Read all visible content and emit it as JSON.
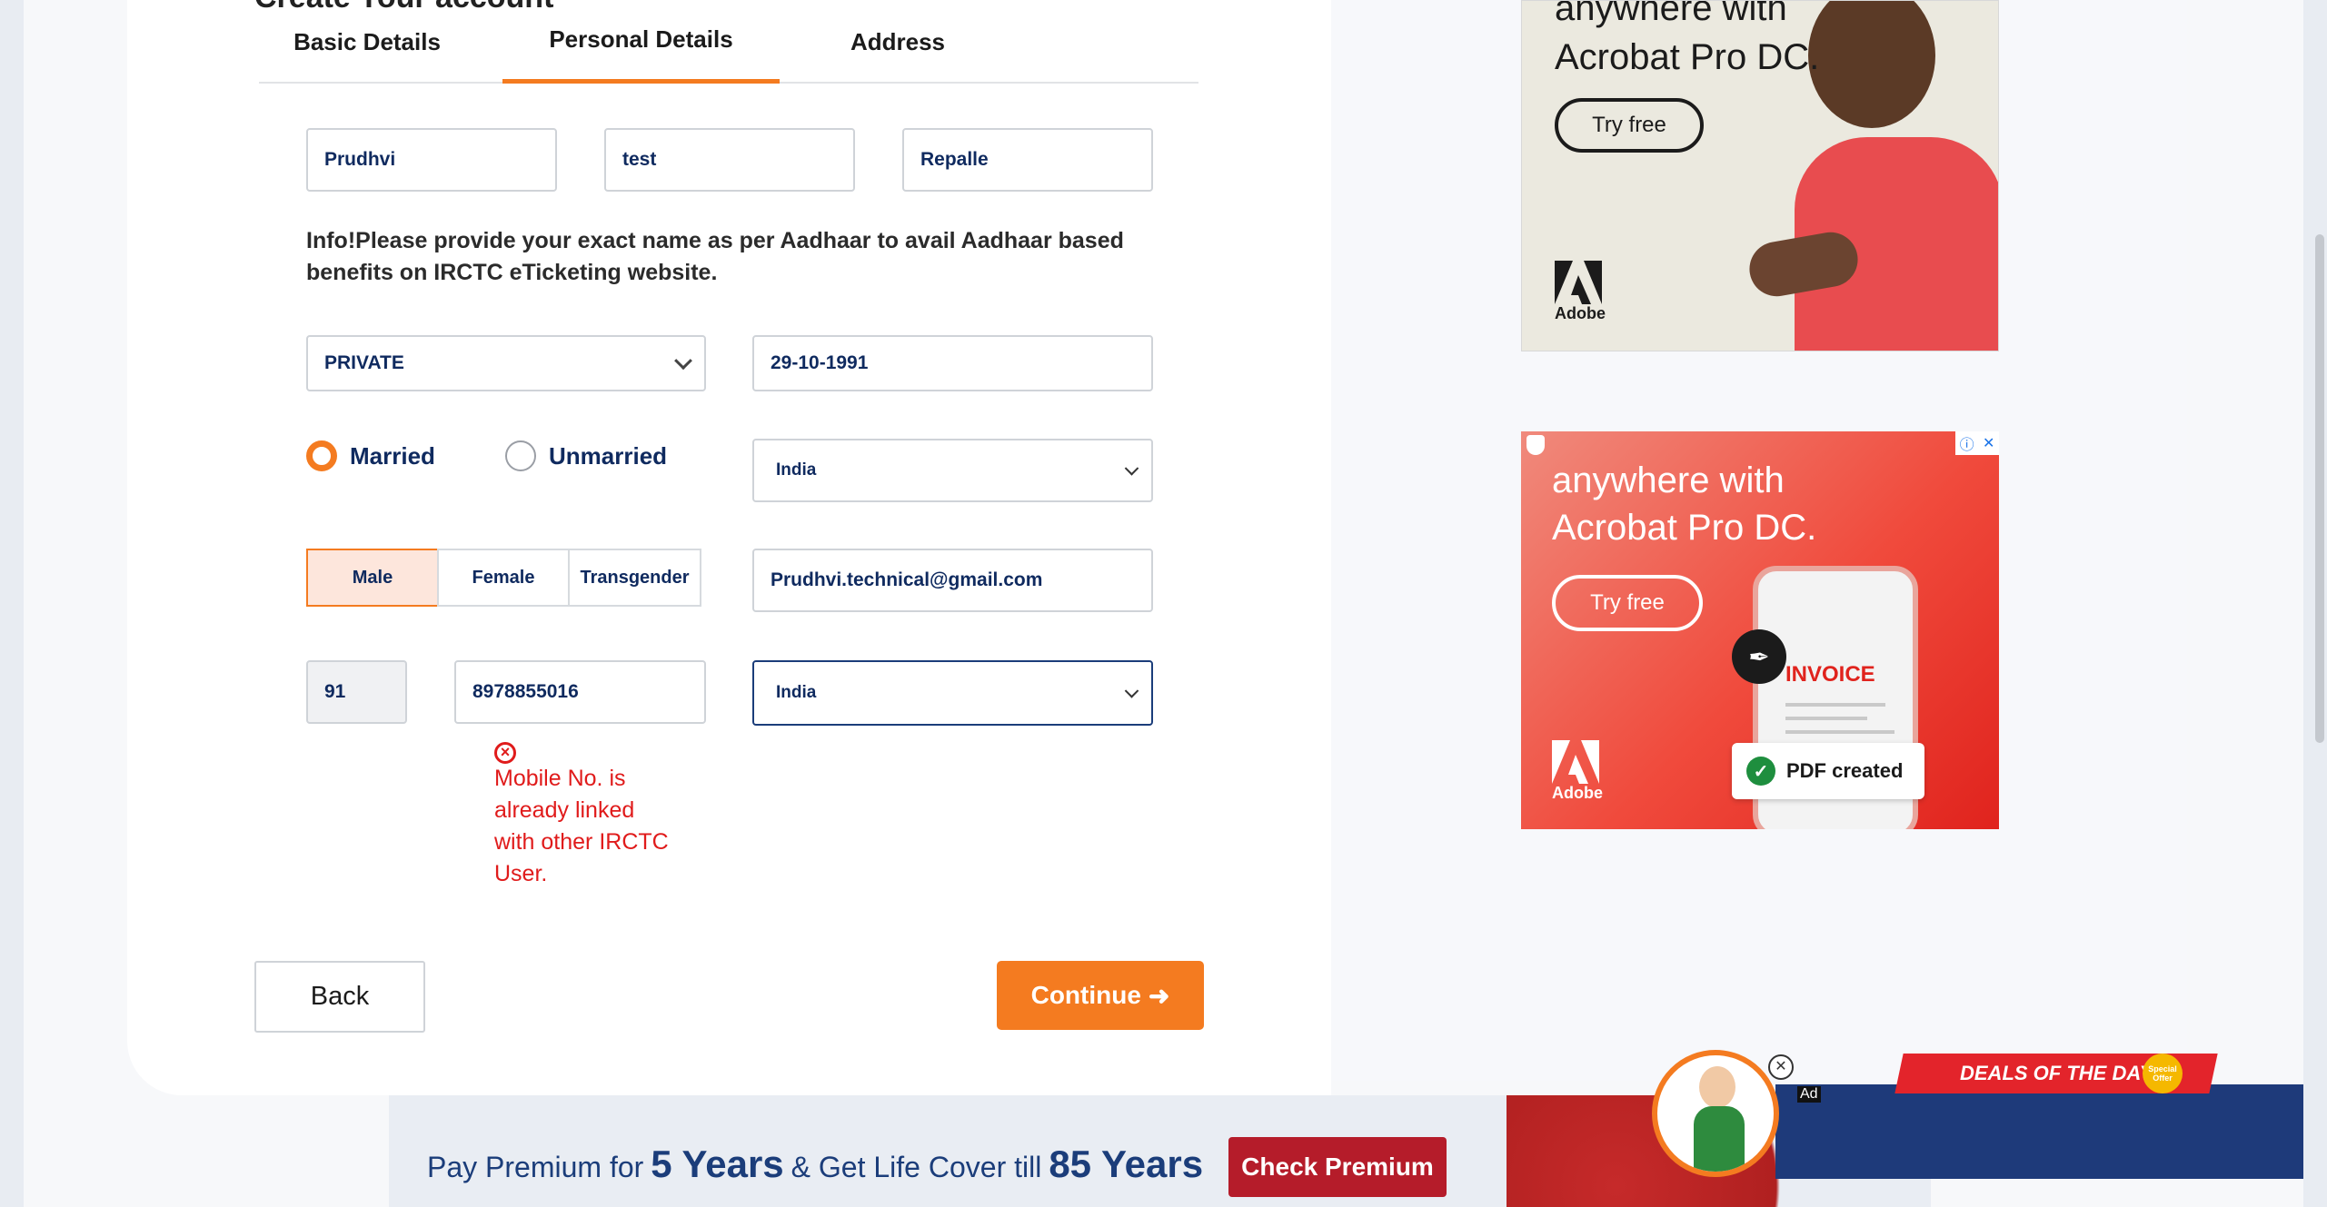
{
  "form": {
    "heading": "Create Your account",
    "tabs": [
      {
        "label": "Basic Details"
      },
      {
        "label": "Personal Details"
      },
      {
        "label": "Address"
      }
    ],
    "first_name": "Prudhvi",
    "middle_name": "test",
    "last_name": "Repalle",
    "info_text": "Info!Please provide your exact name as per Aadhaar to avail Aadhaar based benefits on IRCTC eTicketing website.",
    "occupation": "PRIVATE",
    "dob": "29-10-1991",
    "marital": {
      "married": "Married",
      "unmarried": "Unmarried",
      "selected": "Married"
    },
    "country": "India",
    "gender": {
      "male": "Male",
      "female": "Female",
      "transgender": "Transgender",
      "selected": "Male"
    },
    "email": "Prudhvi.technical@gmail.com",
    "isd_code": "91",
    "mobile": "8978855016",
    "nationality": "India",
    "error_icon": "x-circle-icon",
    "error_text": "Mobile No. is already linked with other IRCTC User.",
    "back_label": "Back",
    "continue_label": "Continue",
    "continue_icon": "➜"
  },
  "ads": {
    "ad1": {
      "line1": "anywhere with",
      "line2": "Acrobat Pro DC.",
      "cta": "Try free",
      "brand": "Adobe"
    },
    "ad2": {
      "line1": "anywhere with",
      "line2": "Acrobat Pro DC.",
      "cta": "Try free",
      "brand": "Adobe",
      "invoice": "INVOICE",
      "badge": "PDF created",
      "choices_info": "ⓘ",
      "choices_close": "✕"
    },
    "banner": {
      "pre": "Pay Premium for",
      "years1": "5 Years",
      "mid": "& Get Life Cover till",
      "years2": "85 Years",
      "cta": "Check Premium"
    },
    "floating": {
      "deals": "DEALS OF THE DAY",
      "special": "Special Offer",
      "ad_label": "Ad",
      "close": "✕"
    }
  },
  "colors": {
    "accent": "#f47b20",
    "error": "#e01b1b",
    "navy": "#0f2a5f"
  }
}
